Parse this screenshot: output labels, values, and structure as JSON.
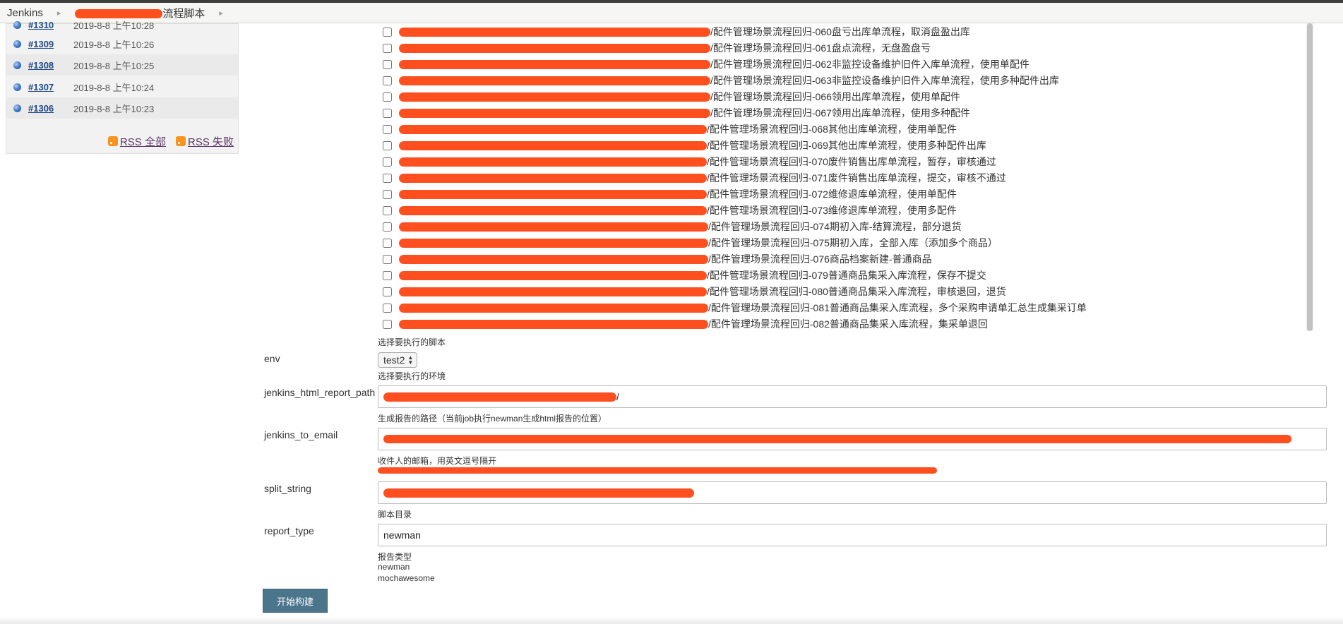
{
  "breadcrumb": {
    "home": "Jenkins",
    "job_suffix": "流程脚本"
  },
  "sidebar": {
    "builds": [
      {
        "id": "#1310",
        "time": "2019-8-8 上午10:28"
      },
      {
        "id": "#1309",
        "time": "2019-8-8 上午10:26"
      },
      {
        "id": "#1308",
        "time": "2019-8-8 上午10:25"
      },
      {
        "id": "#1307",
        "time": "2019-8-8 上午10:24"
      },
      {
        "id": "#1306",
        "time": "2019-8-8 上午10:23"
      }
    ],
    "rss_all": "RSS 全部",
    "rss_fail": "RSS 失败"
  },
  "scripts": {
    "items": [
      "/配件管理场景流程回归-060盘亏出库单流程，取消盘盈出库",
      "/配件管理场景流程回归-061盘点流程，无盘盈盘亏",
      "/配件管理场景流程回归-062非监控设备维护旧件入库单流程，使用单配件",
      "/配件管理场景流程回归-063非监控设备维护旧件入库单流程，使用多种配件出库",
      "/配件管理场景流程回归-066领用出库单流程，使用单配件",
      "/配件管理场景流程回归-067领用出库单流程，使用多种配件",
      "/配件管理场景流程回归-068其他出库单流程，使用单配件",
      "/配件管理场景流程回归-069其他出库单流程，使用多种配件出库",
      "/配件管理场景流程回归-070废件销售出库单流程，暂存，审核通过",
      "/配件管理场景流程回归-071废件销售出库单流程，提交，审核不通过",
      "/配件管理场景流程回归-072维修退库单流程，使用单配件",
      "/配件管理场景流程回归-073维修退库单流程，使用多配件",
      "/配件管理场景流程回归-074期初入库-结算流程，部分退货",
      "/配件管理场景流程回归-075期初入库，全部入库（添加多个商品）",
      "/配件管理场景流程回归-076商品档案新建-普通商品",
      "/配件管理场景流程回归-079普通商品集采入库流程，保存不提交",
      "/配件管理场景流程回归-080普通商品集采入库流程，审核退回，退货",
      "/配件管理场景流程回归-081普通商品集采入库流程，多个采购申请单汇总生成集采订单",
      "/配件管理场景流程回归-082普通商品集采入库流程，集采单退回"
    ],
    "help": "选择要执行的脚本"
  },
  "params": {
    "env": {
      "label": "env",
      "value": "test2",
      "help": "选择要执行的环境"
    },
    "report_path": {
      "label": "jenkins_html_report_path",
      "value_suffix": "/",
      "help": "生成报告的路径（当前job执行newman生成html报告的位置）"
    },
    "email": {
      "label": "jenkins_to_email",
      "help": "收件人的邮箱，用英文逗号隔开"
    },
    "split": {
      "label": "split_string",
      "help": "脚本目录"
    },
    "report_type": {
      "label": "report_type",
      "value": "newman",
      "help_title": "报告类型",
      "opt1": "newman",
      "opt2": "mochawesome"
    }
  },
  "submit_label": "开始构建",
  "colors": {
    "redaction": "#ff4f1f",
    "button": "#4b758b",
    "link": "#204a87"
  }
}
